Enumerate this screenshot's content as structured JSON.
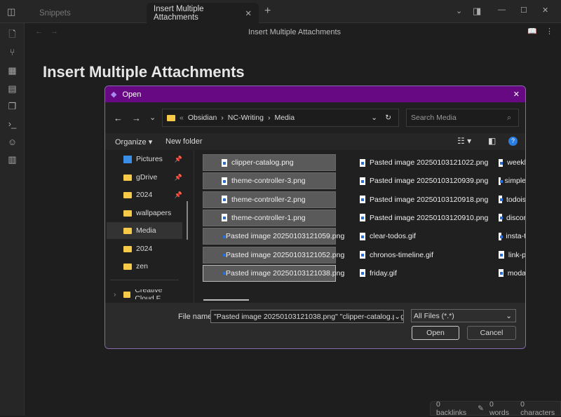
{
  "app": {
    "tabs": [
      {
        "label": "Snippets"
      },
      {
        "label": "Insert Multiple Attachments"
      }
    ],
    "header_title": "Insert Multiple Attachments",
    "note_title": "Insert Multiple Attachments",
    "status": {
      "backlinks": "0 backlinks",
      "words": "0 words",
      "characters": "0 characters"
    }
  },
  "dialog": {
    "title": "Open",
    "accent": "#680984",
    "breadcrumb": [
      "Obsidian",
      "NC-Writing",
      "Media"
    ],
    "search_placeholder": "Search Media",
    "toolbar": {
      "organize": "Organize",
      "new_folder": "New folder"
    },
    "nav": [
      {
        "label": "Pictures",
        "pinned": true
      },
      {
        "label": "gDrive",
        "pinned": true
      },
      {
        "label": "2024",
        "pinned": true
      },
      {
        "label": "wallpapers"
      },
      {
        "label": "Media",
        "selected": true
      },
      {
        "label": "2024"
      },
      {
        "label": "zen"
      },
      {
        "label": "Creative Cloud F"
      }
    ],
    "files_col1": [
      {
        "name": "clipper-catalog.png",
        "selected": true
      },
      {
        "name": "theme-controller-3.png",
        "selected": true
      },
      {
        "name": "theme-controller-2.png",
        "selected": true
      },
      {
        "name": "theme-controller-1.png",
        "selected": true
      },
      {
        "name": "Pasted image 20250103121059.png",
        "selected": true
      },
      {
        "name": "Pasted image 20250103121052.png",
        "selected": true
      },
      {
        "name": "Pasted image 20250103121038.png",
        "selected": true,
        "focused": true
      }
    ],
    "files_col2": [
      "Pasted image 20250103121022.png",
      "Pasted image 20250103120939.png",
      "Pasted image 20250103120918.png",
      "Pasted image 20250103120910.png",
      "clear-todos.gif",
      "chronos-timeline.gif",
      "friday.gif"
    ],
    "files_col3": [
      "weekl",
      "simple",
      "todois",
      "discor",
      "insta-t",
      "link-p",
      "moda"
    ],
    "file_name_label": "File name:",
    "file_name_value": "\"Pasted image 20250103121038.png\" \"clipper-catalog.png\" \"t",
    "file_type": "All Files (*.*)",
    "open_button": "Open",
    "cancel_button": "Cancel"
  }
}
